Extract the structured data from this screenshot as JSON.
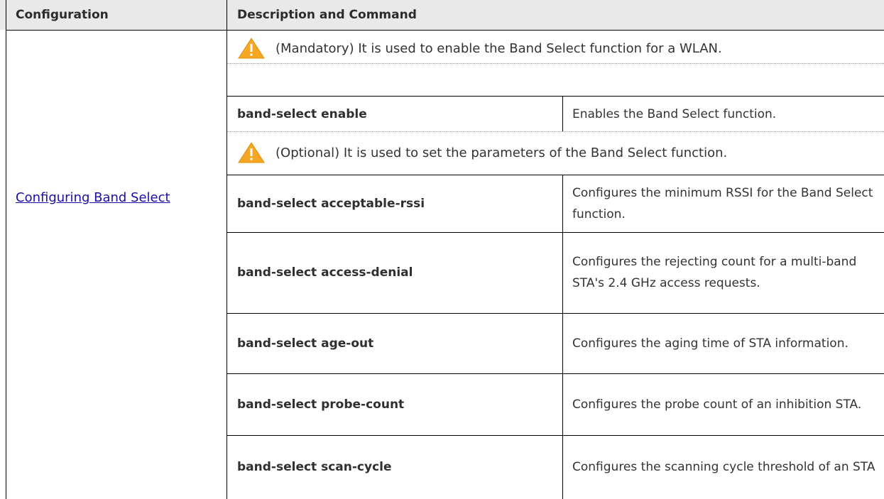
{
  "header": {
    "col1": "Configuration",
    "col2": "Description and Command"
  },
  "config_link": "Configuring Band Select",
  "notes": [
    {
      "icon": "warning-icon",
      "text": "(Mandatory) It is used to enable the Band Select function for a WLAN."
    },
    {
      "icon": "warning-icon",
      "text": "(Optional) It is used to set the parameters of the Band Select function."
    }
  ],
  "rows": [
    {
      "command": "band-select enable",
      "description": "Enables the Band Select function."
    },
    {
      "command": "band-select acceptable-rssi",
      "description": "Configures the minimum RSSI for the Band Select function."
    },
    {
      "command": "band-select access-denial",
      "description": "Configures the rejecting count for a multi-band STA's 2.4 GHz access requests."
    },
    {
      "command": "band-select age-out",
      "description": "Configures the aging time of STA information."
    },
    {
      "command": "band-select probe-count",
      "description": "Configures the probe count of an inhibition STA."
    },
    {
      "command": "band-select scan-cycle",
      "description": "Configures the scanning cycle threshold of an STA"
    }
  ],
  "colors": {
    "header_bg": "#e9e9e9",
    "link": "#1a0dab",
    "warning_fill": "#f5a623"
  }
}
